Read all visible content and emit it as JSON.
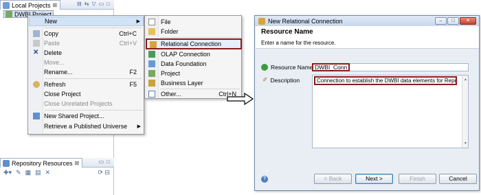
{
  "left_view": {
    "tab_label": "Local Projects",
    "tab_close": "⊠",
    "selected_item": "DWBI Project"
  },
  "repo_view": {
    "tab_label": "Repository Resources",
    "tab_close": "⊠"
  },
  "context_menu": {
    "items": [
      {
        "label": "New",
        "shortcut": "",
        "submenu": true,
        "disabled": false,
        "icon": "none"
      },
      {
        "label": "Copy",
        "shortcut": "Ctrl+C",
        "submenu": false,
        "disabled": false,
        "icon": "copy-icon"
      },
      {
        "label": "Paste",
        "shortcut": "Ctrl+V",
        "submenu": false,
        "disabled": true,
        "icon": "paste-icon"
      },
      {
        "label": "Delete",
        "shortcut": "",
        "submenu": false,
        "disabled": false,
        "icon": "delete-icon"
      },
      {
        "label": "Move...",
        "shortcut": "",
        "submenu": false,
        "disabled": true,
        "icon": "none"
      },
      {
        "label": "Rename...",
        "shortcut": "F2",
        "submenu": false,
        "disabled": false,
        "icon": "none"
      },
      {
        "label": "Refresh",
        "shortcut": "F5",
        "submenu": false,
        "disabled": false,
        "icon": "refresh-icon"
      },
      {
        "label": "Close Project",
        "shortcut": "",
        "submenu": false,
        "disabled": false,
        "icon": "none"
      },
      {
        "label": "Close Unrelated Projects",
        "shortcut": "",
        "submenu": false,
        "disabled": true,
        "icon": "none"
      },
      {
        "label": "New Shared Project...",
        "shortcut": "",
        "submenu": false,
        "disabled": false,
        "icon": "shared-project-icon"
      },
      {
        "label": "Retrieve a Published Universe",
        "shortcut": "",
        "submenu": true,
        "disabled": false,
        "icon": "none"
      }
    ]
  },
  "submenu": {
    "items": [
      {
        "label": "File",
        "shortcut": "",
        "icon": "file-icon"
      },
      {
        "label": "Folder",
        "shortcut": "",
        "icon": "folder-icon"
      },
      {
        "label": "Relational Connection",
        "shortcut": "",
        "icon": "relational-connection-icon"
      },
      {
        "label": "OLAP Connection",
        "shortcut": "",
        "icon": "olap-connection-icon"
      },
      {
        "label": "Data Foundation",
        "shortcut": "",
        "icon": "data-foundation-icon"
      },
      {
        "label": "Project",
        "shortcut": "",
        "icon": "project-icon"
      },
      {
        "label": "Business Layer",
        "shortcut": "",
        "icon": "business-layer-icon"
      },
      {
        "label": "Other...",
        "shortcut": "Ctrl+N",
        "icon": "other-icon"
      }
    ]
  },
  "dialog": {
    "title": "New Relational Connection",
    "header_title": "Resource Name",
    "header_desc": "Enter a name for the resource.",
    "resource_name_label": "Resource Name",
    "resource_name_value": "DWBI_Conn",
    "description_label": "Description",
    "description_value": "Connection to establish the DWBI data elements for Reporting",
    "back_label": "< Back",
    "next_label": "Next >",
    "finish_label": "Finish",
    "cancel_label": "Cancel"
  },
  "colors": {
    "highlight_border": "#8b1a1a",
    "menu_hover": "#d3e2f5",
    "dialog_bg": "#e9eef5"
  }
}
